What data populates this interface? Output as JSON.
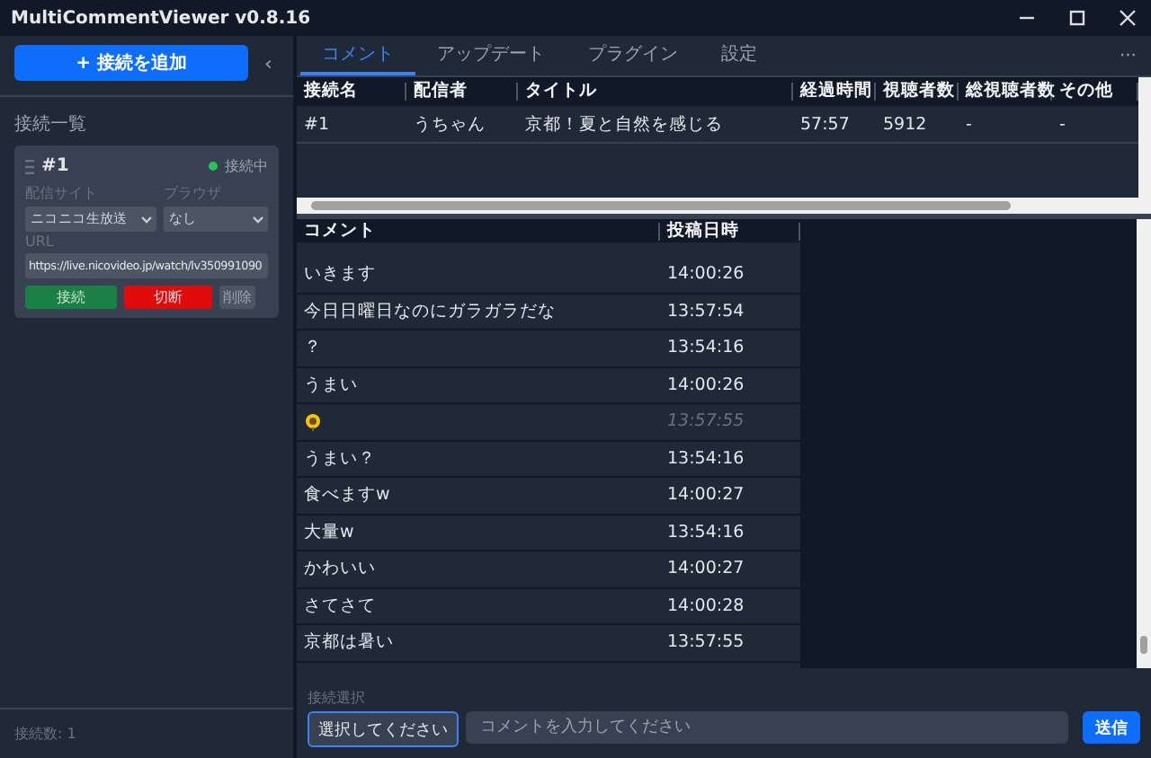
{
  "window": {
    "title": "MultiCommentViewer v0.8.16"
  },
  "sidebar": {
    "add_button": "+ 接続を追加",
    "collapse": "‹",
    "section_title": "接続一覧",
    "connection": {
      "name": "#1",
      "status": "接続中",
      "site_label": "配信サイト",
      "site_value": "ニコニコ生放送",
      "browser_label": "ブラウザ",
      "browser_value": "なし",
      "url_label": "URL",
      "url_value": "https://live.nicovideo.jp/watch/lv350991090",
      "buttons": [
        {
          "label": "接続",
          "kind": "connect"
        },
        {
          "label": "切断",
          "kind": "disconnect"
        },
        {
          "label": "削除",
          "kind": "delete"
        }
      ]
    },
    "footer": "接続数: 1"
  },
  "tabs": [
    {
      "label": "コメント",
      "selected": true
    },
    {
      "label": "アップデート",
      "selected": false
    },
    {
      "label": "プラグイン",
      "selected": false
    },
    {
      "label": "設定",
      "selected": false
    }
  ],
  "more": "···",
  "connections_table": {
    "columns": [
      "接続名",
      "配信者",
      "タイトル",
      "経過時間",
      "視聴者数",
      "総視聴者数",
      "その他"
    ],
    "rows": [
      [
        "#1",
        "うちゃん",
        "京都！夏と自然を感じる",
        "57:57",
        "5912",
        "-",
        "-"
      ]
    ]
  },
  "comments_table": {
    "columns": [
      "コメント",
      "投稿日時"
    ],
    "rows": [
      {
        "kind": "text",
        "text": "いきます",
        "time": "14:00:26",
        "dimmed": false
      },
      {
        "kind": "text",
        "text": "今日日曜日なのにガラガラだな",
        "time": "13:57:54",
        "dimmed": false
      },
      {
        "kind": "text",
        "text": "？",
        "time": "13:54:16",
        "dimmed": false
      },
      {
        "kind": "text",
        "text": "うまい",
        "time": "14:00:26",
        "dimmed": false
      },
      {
        "kind": "sticker",
        "time": "13:57:55",
        "dimmed": true
      },
      {
        "kind": "text",
        "text": "うまい？",
        "time": "13:54:16",
        "dimmed": false
      },
      {
        "kind": "text",
        "text": "食べますw",
        "time": "14:00:27",
        "dimmed": false
      },
      {
        "kind": "text",
        "text": "大量w",
        "time": "13:54:16",
        "dimmed": false
      },
      {
        "kind": "text",
        "text": "かわいい",
        "time": "14:00:27",
        "dimmed": false
      },
      {
        "kind": "text",
        "text": "さてさて",
        "time": "14:00:28",
        "dimmed": false
      },
      {
        "kind": "text",
        "text": "京都は暑い",
        "time": "13:57:55",
        "dimmed": false
      }
    ]
  },
  "composer": {
    "select_label": "接続選択",
    "select_value": "選択してください",
    "placeholder": "コメントを入力してください",
    "send": "送信"
  }
}
